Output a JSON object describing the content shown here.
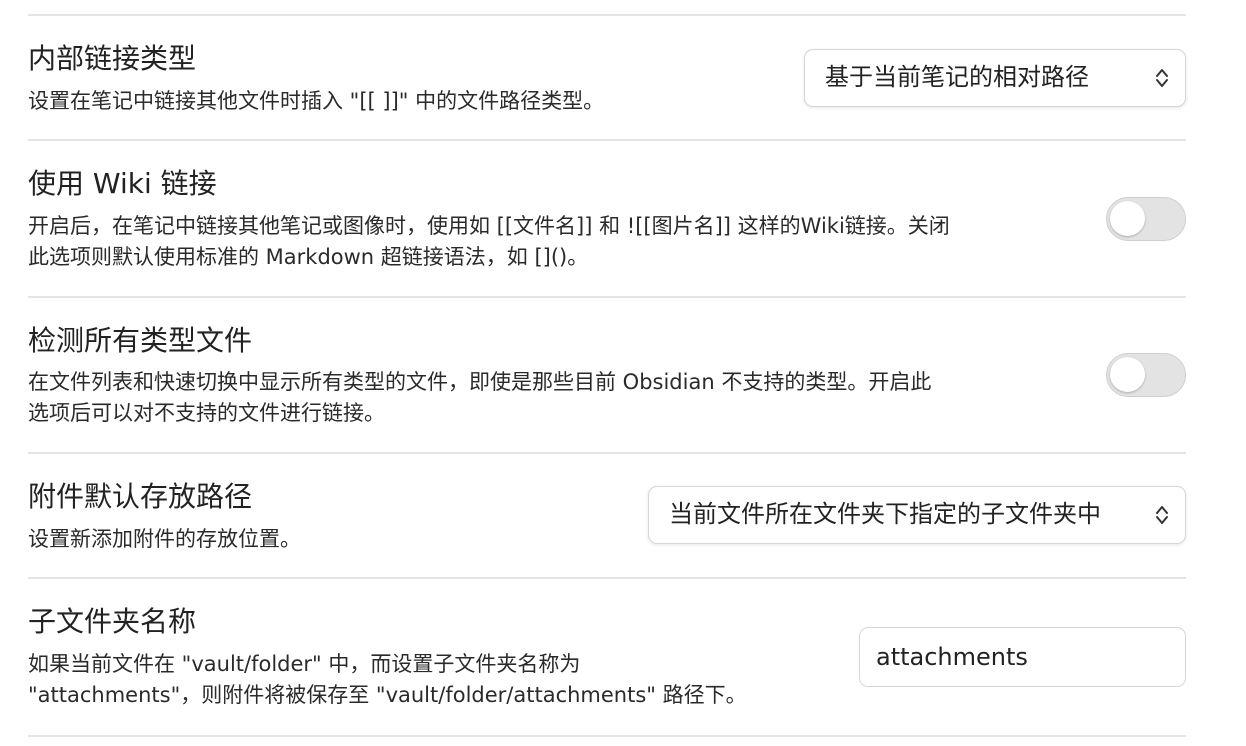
{
  "settings": [
    {
      "name": "内部链接类型",
      "description_lines": [
        "设置在笔记中链接其他文件时插入 \"[[ ]]\" 中的文件路径类型。"
      ],
      "control": "dropdown",
      "value": "基于当前笔记的相对路径"
    },
    {
      "name": "使用 Wiki 链接",
      "description_lines": [
        "开启后，在笔记中链接其他笔记或图像时，使用如 [[文件名]] 和 ![[图片名]] 这样的Wiki链接。关闭",
        "此选项则默认使用标准的 Markdown 超链接语法，如 []()。"
      ],
      "control": "toggle",
      "enabled": false
    },
    {
      "name": "检测所有类型文件",
      "description_lines": [
        "在文件列表和快速切换中显示所有类型的文件，即使是那些目前 Obsidian 不支持的类型。开启此",
        "选项后可以对不支持的文件进行链接。"
      ],
      "control": "toggle",
      "enabled": false
    },
    {
      "name": "附件默认存放路径",
      "description_lines": [
        "设置新添加附件的存放位置。"
      ],
      "control": "dropdown",
      "value": "当前文件所在文件夹下指定的子文件夹中"
    },
    {
      "name": "子文件夹名称",
      "description_lines": [
        "如果当前文件在 \"vault/folder\" 中，而设置子文件夹名称为",
        "\"attachments\"，则附件将被保存至 \"vault/folder/attachments\" 路径下。"
      ],
      "control": "text",
      "value": "attachments"
    }
  ]
}
